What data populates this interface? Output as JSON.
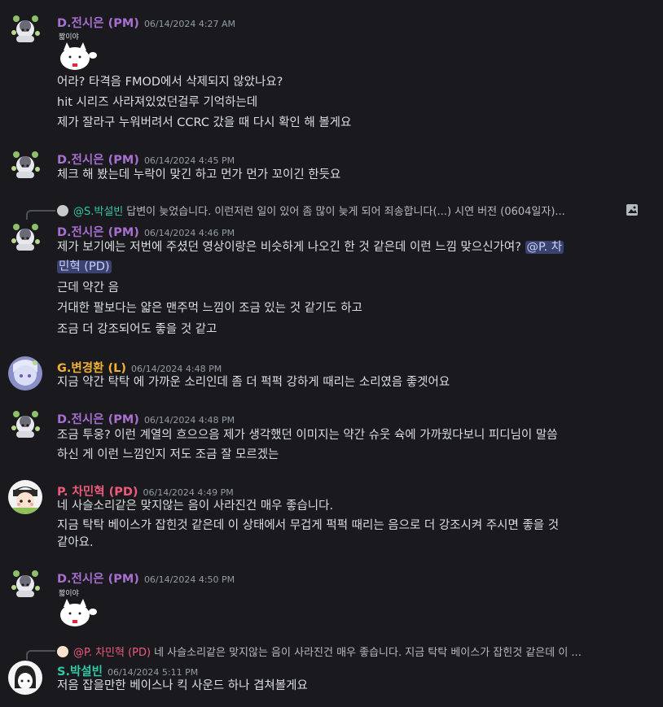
{
  "colors": {
    "pm": "#a66fd0",
    "leader": "#f0b232",
    "pd": "#ee5a7c",
    "sound": "#33c7a7"
  },
  "messages": [
    {
      "author": "D.전시은 (PM)",
      "timestamp": "06/14/2024 4:27 AM",
      "sticker_text": "짧이야",
      "lines": [
        "어라? 타격음 FMOD에서 삭제되지 않았나요?",
        "hit 시리즈 사라져있었던걸루 기억하는데",
        "제가 잘라구 누워버려서 CCRC 갔을 때 다시 확인 해 볼게요"
      ]
    },
    {
      "author": "D.전시은 (PM)",
      "timestamp": "06/14/2024 4:45 PM",
      "lines": [
        "체크 해 봤는데 누락이 맞긴 하고 먼가 먼가 꼬이긴 한듯요"
      ]
    },
    {
      "reply_to": "@S.박설빈",
      "reply_text": "답변이 늦었습니다. 이런저런 일이 있어 좀 많이 늦게 되어 죄송합니다(...)  시연 버전 (0604일자)...",
      "author": "D.전시은 (PM)",
      "timestamp": "06/14/2024 4:46 PM",
      "line1_text": "제가 보기에는 저번에 주셨던 영상이랑은 비슷하게 나오긴 한 것 같은데 이런 느낌 맞으신가여?",
      "line1_mention_a": "@P. 차",
      "line1_mention_b": "민혁 (PD)",
      "lines": [
        "근데 약간 음",
        "거대한 팔보다는 얇은 맨주먹 느낌이 조금 있는 것 같기도 하고",
        "조금 더 강조되어도 좋을 것 같고"
      ]
    },
    {
      "author": "G.변경환 (L)",
      "timestamp": "06/14/2024 4:48 PM",
      "lines": [
        "지금 약간 탁탁 에 가까운 소리인데 좀 더 퍽퍽 강하게 때리는 소리였음 좋겟어요"
      ]
    },
    {
      "author": "D.전시은 (PM)",
      "timestamp": "06/14/2024 4:48 PM",
      "lines": [
        "조금 투웅? 이런 계열의 흐으으음 제가 생각했던 이미지는 약간 슈웃 슉에 가까웠다보니 피디님이 말씀",
        "하신 게 이런 느낌인지 저도 조금 잘 모르겠는"
      ]
    },
    {
      "author": "P. 차민혁 (PD)",
      "timestamp": "06/14/2024 4:49 PM",
      "lines": [
        "네 사슬소리같은 맞지않는 음이 사라진건 매우 좋습니다.",
        "지금 탁탁 베이스가 잡힌것 같은데 이 상태에서 무겁게 퍽퍽 때리는 음으로 더 강조시켜 주시면 좋을 것",
        "같아요."
      ]
    },
    {
      "author": "D.전시은 (PM)",
      "timestamp": "06/14/2024 4:50 PM",
      "sticker_text": "짧이야"
    },
    {
      "reply_to": "@P. 차민혁 (PD)",
      "reply_text": "네 사슬소리같은 맞지않는 음이 사라진건 매우 좋습니다. 지금 탁탁 베이스가 잡힌것 같은데 이 ...",
      "author": "S.박설빈",
      "timestamp": "06/14/2024 5:11 PM",
      "lines": [
        "저음 잡을만한 베이스나 킥 사운드 하나 겹쳐볼게요"
      ]
    }
  ]
}
